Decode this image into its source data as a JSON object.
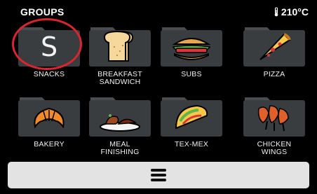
{
  "header": {
    "title": "GROUPS",
    "temperature": "210°C",
    "temperature_icon": "thermometer-icon"
  },
  "groups": [
    {
      "label": "SNACKS",
      "icon": "letter-s-icon",
      "glyph": "S"
    },
    {
      "label": "BREAKFAST\nSANDWICH",
      "icon": "toast-icon"
    },
    {
      "label": "SUBS",
      "icon": "sub-sandwich-icon"
    },
    {
      "label": "PIZZA",
      "icon": "pizza-slice-icon"
    },
    {
      "label": "BAKERY",
      "icon": "croissant-icon"
    },
    {
      "label": "MEAL\nFINISHING",
      "icon": "plated-meal-icon"
    },
    {
      "label": "TEX-MEX",
      "icon": "taco-icon"
    },
    {
      "label": "CHICKEN\nWINGS",
      "icon": "chicken-wings-icon"
    }
  ],
  "menu_bar": {
    "icon": "hamburger-menu-icon"
  },
  "colors": {
    "background": "#000000",
    "folder": "#3a3d40",
    "folder_light": "#4a4d50",
    "highlight": "#d9262e",
    "menu_bar": "#e3e3e3"
  }
}
